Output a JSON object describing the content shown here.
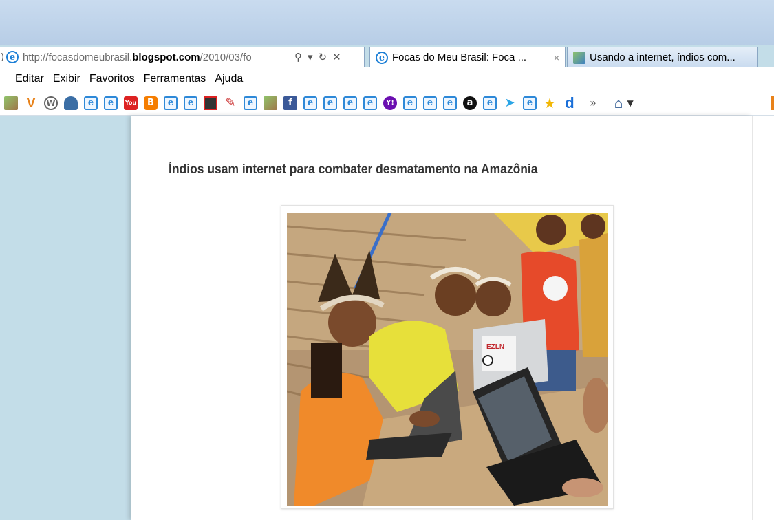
{
  "browser": {
    "address_bar": {
      "url_prefix": "http://focasdomeubrasil.",
      "url_domain": "blogspot.com",
      "url_path": "/2010/03/fo",
      "search_glyph": "⚲",
      "dropdown_glyph": "▾",
      "refresh_glyph": "↻",
      "stop_glyph": "✕"
    },
    "tabs": [
      {
        "label": "Focas do Meu Brasil: Foca ...",
        "close": "×"
      },
      {
        "label": "Usando a internet, índios com..."
      }
    ],
    "menu": [
      "Editar",
      "Exibir",
      "Favoritos",
      "Ferramentas",
      "Ajuda"
    ],
    "favorites_overflow": "»"
  },
  "article": {
    "title": "Índios usam internet para combater desmatamento na Amazônia",
    "image_sticker_text": "EZLN"
  }
}
